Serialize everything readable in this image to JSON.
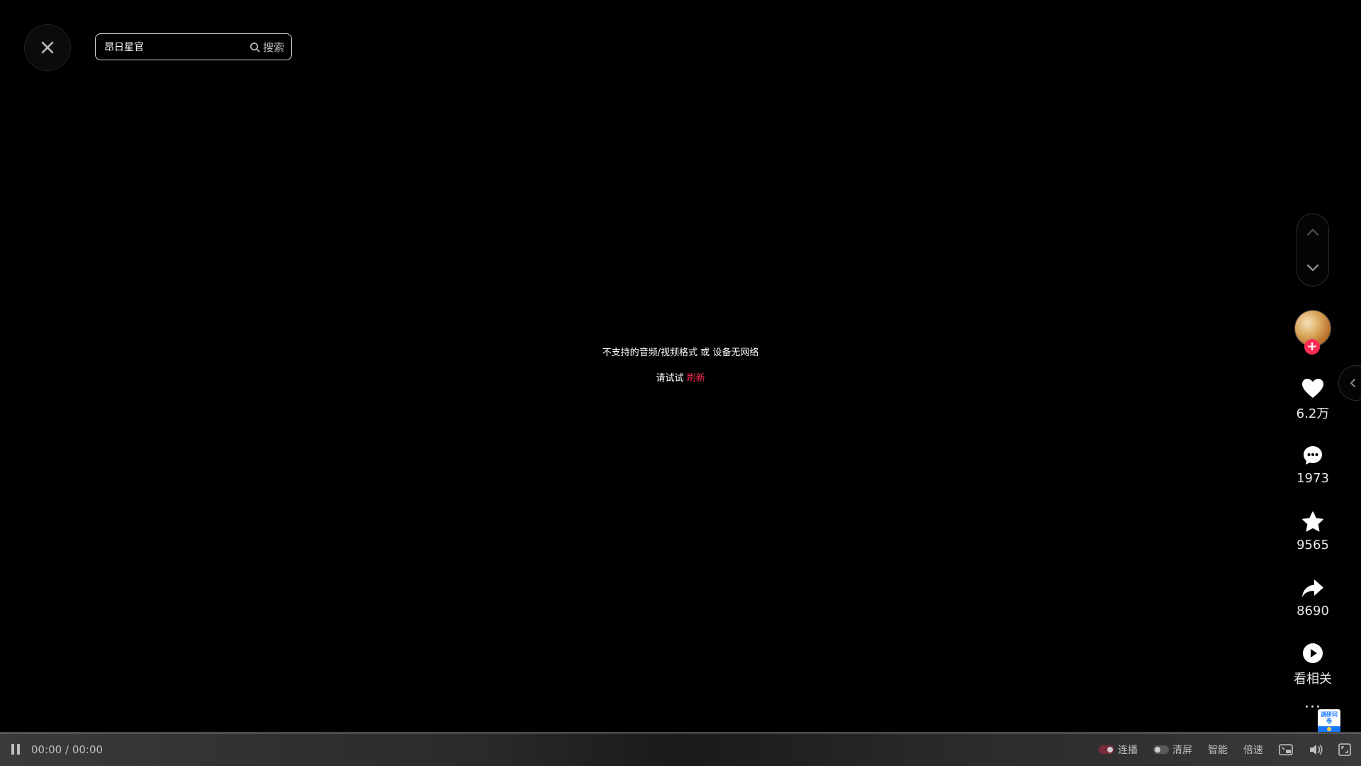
{
  "search": {
    "value": "昂日星官",
    "button_label": "搜索"
  },
  "error": {
    "message": "不支持的音频/视频格式 或 设备无网络",
    "retry_prefix": "请试试",
    "refresh_label": "刷新"
  },
  "actions": {
    "follow_label": "+",
    "like_count": "6.2万",
    "comment_count": "1973",
    "favorite_count": "9565",
    "share_count": "8690",
    "related_label": "看相关",
    "more_label": "···",
    "survey_label": "调研问卷"
  },
  "player": {
    "time": "00:00 / 00:00",
    "autoplay_label": "连播",
    "autoplay_on": true,
    "clear_screen_label": "清屏",
    "clear_screen_on": false,
    "smart_label": "智能",
    "speed_label": "倍速"
  },
  "colors": {
    "accent": "#fe2c55",
    "background": "#000000"
  },
  "icons": {
    "close": "close-icon",
    "search": "search-icon",
    "nav_up": "chevron-up-icon",
    "nav_down": "chevron-down-icon",
    "like": "heart-icon",
    "comment": "comment-icon",
    "favorite": "star-icon",
    "share": "share-icon",
    "related": "play-icon",
    "side_tab": "chevron-left-icon",
    "pause": "pause-icon",
    "pip": "picture-in-picture-icon",
    "volume": "volume-icon",
    "fullscreen": "fullscreen-icon"
  }
}
